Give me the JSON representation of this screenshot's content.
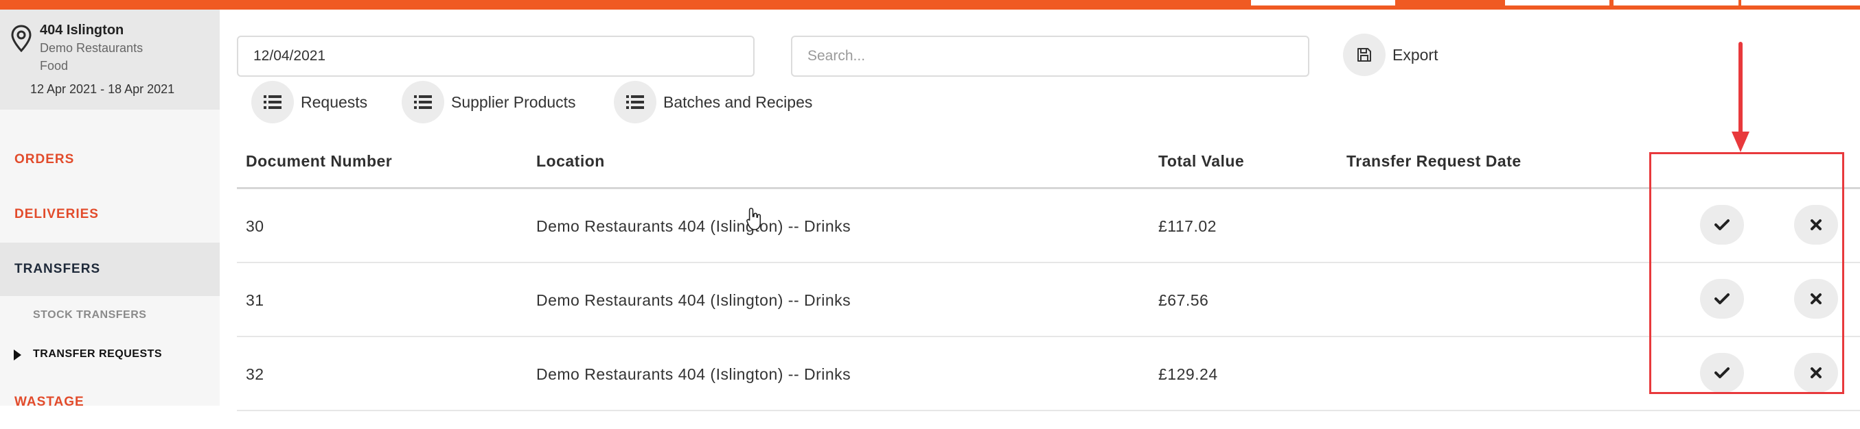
{
  "colors": {
    "accent": "#f05a22",
    "nav_link": "#e24b2b",
    "annotation": "#e8393c"
  },
  "site": {
    "name": "404 Islington",
    "organisation": "Demo Restaurants",
    "category": "Food",
    "date_range": "12 Apr 2021 - 18 Apr 2021",
    "icon": "map-pin-icon"
  },
  "nav": {
    "orders": "ORDERS",
    "deliveries": "DELIVERIES",
    "transfers": "TRANSFERS",
    "stock_transfers": "STOCK TRANSFERS",
    "transfer_requests": "TRANSFER REQUESTS",
    "wastage": "WASTAGE"
  },
  "filters": {
    "date_value": "12/04/2021",
    "search_placeholder": "Search...",
    "export_label": "Export"
  },
  "view_buttons": {
    "requests": "Requests",
    "supplier_products": "Supplier Products",
    "batches_and_recipes": "Batches and Recipes"
  },
  "table": {
    "columns": {
      "document_number": "Document Number",
      "location": "Location",
      "total_value": "Total Value",
      "transfer_request_date": "Transfer Request Date"
    },
    "rows": [
      {
        "document_number": "30",
        "location": "Demo Restaurants 404 (Islington) -- Drinks",
        "total_value": "£117.02",
        "transfer_request_date": ""
      },
      {
        "document_number": "31",
        "location": "Demo Restaurants 404 (Islington) -- Drinks",
        "total_value": "£67.56",
        "transfer_request_date": ""
      },
      {
        "document_number": "32",
        "location": "Demo Restaurants 404 (Islington) -- Drinks",
        "total_value": "£129.24",
        "transfer_request_date": ""
      }
    ]
  }
}
